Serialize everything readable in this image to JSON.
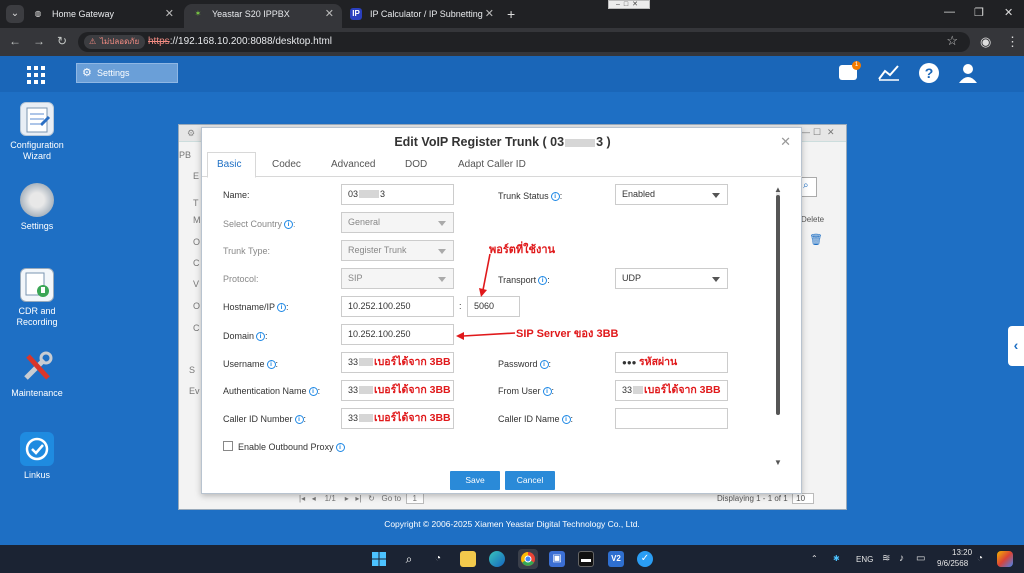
{
  "browser": {
    "tabs": [
      {
        "title": "Home Gateway"
      },
      {
        "title": "Yeastar S20 IPPBX"
      },
      {
        "title": "IP Calculator / IP Subnetting"
      }
    ],
    "security_label": "ไม่ปลอดภัย",
    "url_scheme": "https",
    "url_rest": "://192.168.10.200:8088/desktop.html"
  },
  "desktop": {
    "active_window_tab": "Settings",
    "icons": [
      {
        "label": "Configuration Wizard"
      },
      {
        "label": "Settings"
      },
      {
        "label": "CDR and Recording"
      },
      {
        "label": "Maintenance"
      },
      {
        "label": "Linkus"
      }
    ],
    "copyright": "Copyright © 2006-2025 Xiamen Yeastar Digital Technology Co., Ltd.",
    "notification_badge": "1"
  },
  "background_window": {
    "side_letters": [
      "PB",
      "E",
      "T",
      "M",
      "O",
      "C",
      "V",
      "O",
      "C",
      "S",
      "Ev"
    ],
    "delete_label": "Delete",
    "pager_page": "1",
    "pager_of": "/1",
    "goto_label": "Go to",
    "goto_value": "1",
    "displaying": "Displaying 1 - 1 of 1",
    "page_size": "10"
  },
  "dialog": {
    "title_prefix": "Edit VoIP Register Trunk ( 03",
    "title_suffix": "3 )",
    "tabs": [
      "Basic",
      "Codec",
      "Advanced",
      "DOD",
      "Adapt Caller ID"
    ],
    "fields": {
      "name_label": "Name:",
      "name_prefix": "03",
      "name_suffix": "3",
      "select_country_label": "Select Country",
      "select_country_value": "General",
      "trunk_type_label": "Trunk Type:",
      "trunk_type_value": "Register Trunk",
      "protocol_label": "Protocol:",
      "protocol_value": "SIP",
      "hostname_label": "Hostname/IP",
      "hostname_value": "10.252.100.250",
      "port_value": "5060",
      "domain_label": "Domain",
      "domain_value": "10.252.100.250",
      "username_label": "Username",
      "username_prefix": "33",
      "auth_name_label": "Authentication Name",
      "auth_prefix": "33",
      "callerid_number_label": "Caller ID Number",
      "callerid_prefix": "33",
      "trunk_status_label": "Trunk Status",
      "trunk_status_value": "Enabled",
      "transport_label": "Transport",
      "transport_value": "UDP",
      "password_label": "Password",
      "password_dots": "●●●",
      "from_user_label": "From User",
      "from_user_prefix": "33",
      "callerid_name_label": "Caller ID Name",
      "outbound_proxy_label": "Enable Outbound Proxy"
    },
    "annotations": {
      "port_used": "พอร์ตที่ใช้งาน",
      "sip_server": "SIP Server ของ 3BB",
      "number_from_3bb": "เบอร์ได้จาก 3BB",
      "password_note": "รหัสผ่าน"
    },
    "save_label": "Save",
    "cancel_label": "Cancel"
  },
  "taskbar": {
    "language": "ENG",
    "time": "13:20",
    "date": "9/6/2568"
  }
}
